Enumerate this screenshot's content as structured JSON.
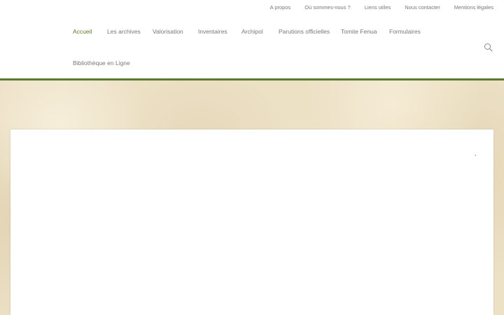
{
  "top_links": [
    {
      "label": "A propos"
    },
    {
      "label": "Où sommes-nous ?"
    },
    {
      "label": "Liens utiles"
    },
    {
      "label": "Nous contacter"
    },
    {
      "label": "Mentions légales"
    }
  ],
  "main_nav": [
    {
      "label": "Accueil",
      "active": true
    },
    {
      "label": "Les archives"
    },
    {
      "label": "Valorisation"
    },
    {
      "label": "Inventaires"
    },
    {
      "label": "Archipol"
    },
    {
      "label": "Parutions officielles"
    },
    {
      "label": "Tomite Fenua"
    },
    {
      "label": "Formulaires"
    },
    {
      "label": "Bibliothèque en Ligne"
    }
  ],
  "search": {
    "icon": "search-icon"
  },
  "content": {
    "mark": ","
  },
  "colors": {
    "accent": "#5a7a2e",
    "nav_text": "#777777",
    "paper": "#ece0c5"
  }
}
